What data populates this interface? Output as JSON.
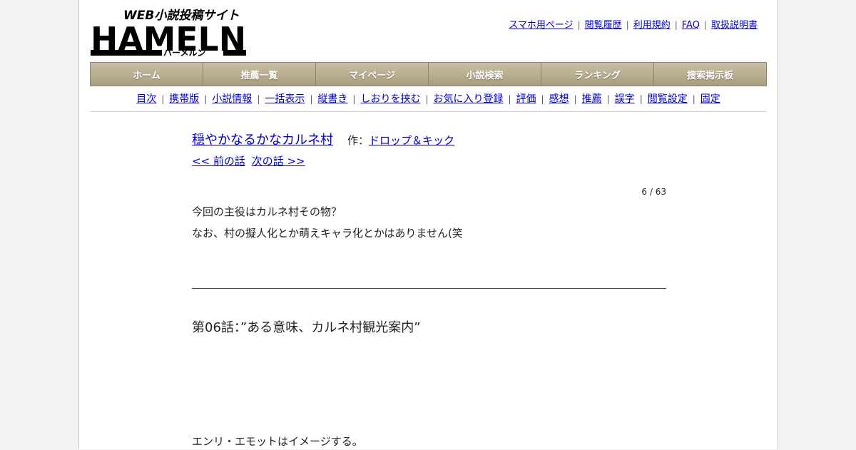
{
  "site": {
    "logo_tagline": "WEB小説投稿サイト",
    "logo_main": "HAMELN",
    "logo_kana": "ハーメルン"
  },
  "top_links": [
    "スマホ用ページ",
    "閲覧履歴",
    "利用規約",
    "FAQ",
    "取扱説明書"
  ],
  "global_nav": [
    "ホーム",
    "推薦一覧",
    "マイページ",
    "小説検索",
    "ランキング",
    "捜索掲示板"
  ],
  "sub_nav": [
    "目次",
    "携帯版",
    "小説情報",
    "一括表示",
    "縦書き",
    "しおりを挟む",
    "お気に入り登録",
    "評価",
    "感想",
    "推薦",
    "誤字",
    "閲覧設定",
    "固定"
  ],
  "separator": "|",
  "novel": {
    "title": "穏やかなるかなカルネ村",
    "author_prefix": "作：",
    "author": "ドロップ＆キック",
    "prev_label": "<< 前の話",
    "next_label": "次の話 >>",
    "progress": "6 / 63",
    "preface": [
      "今回の主役はカルネ村その物？",
      "なお、村の擬人化とか萌えキャラ化とかはありません(笑"
    ],
    "chapter_title": "第06話：”ある意味、カルネ村観光案内”",
    "body": [
      "エンリ・エモットはイメージする。"
    ]
  },
  "colors": {
    "nav_gradient_top": "#c9c0a6",
    "nav_gradient_bottom": "#a89d7d",
    "link": "#0000cc",
    "page_bg": "#f2f2f2"
  }
}
